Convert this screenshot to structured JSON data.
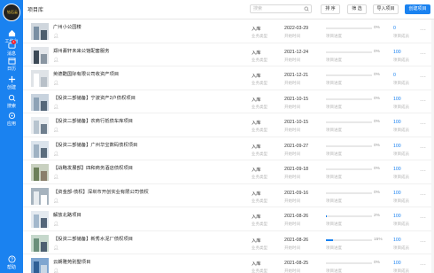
{
  "app": {
    "logo_text": "钻石云"
  },
  "sidebar": {
    "items": [
      {
        "label": "工作台",
        "icon": "home-icon"
      },
      {
        "label": "消息",
        "icon": "message-icon",
        "badge": "1"
      },
      {
        "label": "日历",
        "icon": "calendar-icon"
      },
      {
        "label": "创建",
        "icon": "plus-icon"
      },
      {
        "label": "搜索",
        "icon": "search-icon"
      },
      {
        "label": "应用",
        "icon": "apps-icon"
      },
      {
        "label": "帮助",
        "icon": "help-icon"
      }
    ]
  },
  "header": {
    "title": "项目库",
    "search_placeholder": "搜索",
    "sort_label": "排 序",
    "filter_label": "筛 选",
    "import_label": "导入项目",
    "create_label": "创建项目"
  },
  "columns": {
    "category": "业务类型",
    "date": "开始时间",
    "progress": "项目进度",
    "count": "项目成员"
  },
  "colors": {
    "accent": "#1a82f0"
  },
  "rows": [
    {
      "title": "广州小公园楼",
      "status": "入库",
      "date": "2022-03-29",
      "progress": 0,
      "pct": "0%",
      "count": "0"
    },
    {
      "title": "郑州綦轩未来公馆配套服务",
      "status": "入库",
      "date": "2021-12-24",
      "progress": 0,
      "pct": "0%",
      "count": "100"
    },
    {
      "title": "英德酷国际有限公司收资产项目",
      "status": "入库",
      "date": "2021-12-21",
      "progress": 0,
      "pct": "0%",
      "count": "0"
    },
    {
      "title": "【投资二部储备】宁波资产2户债权项目",
      "status": "入库",
      "date": "2021-10-15",
      "progress": 0,
      "pct": "0%",
      "count": "100"
    },
    {
      "title": "【投资二部储备】农商行抵债车库项目",
      "status": "入库",
      "date": "2021-10-15",
      "progress": 0,
      "pct": "0%",
      "count": "100"
    },
    {
      "title": "【投资二部储备】广州华宝数码债权项目",
      "status": "入库",
      "date": "2021-09-27",
      "progress": 0,
      "pct": "0%",
      "count": "100"
    },
    {
      "title": "【战略发展部】四和商务酒店债权项目",
      "status": "入库",
      "date": "2021-09-18",
      "progress": 0,
      "pct": "0%",
      "count": "100"
    },
    {
      "title": "【资金部-债权】深圳市开创实业有限公司债权",
      "status": "入库",
      "date": "2021-09-16",
      "progress": 0,
      "pct": "0%",
      "count": "100"
    },
    {
      "title": "解放北路项目",
      "status": "入库",
      "date": "2021-08-26",
      "progress": 2,
      "pct": "2%",
      "count": "100"
    },
    {
      "title": "【投资二部储备】新秀水泥厂债权项目",
      "status": "入库",
      "date": "2021-08-26",
      "progress": 15,
      "pct": "15%",
      "count": "100"
    },
    {
      "title": "云朗雅苑别墅项目",
      "status": "入库",
      "date": "2021-08-25",
      "progress": 0,
      "pct": "0%",
      "count": "100"
    }
  ]
}
